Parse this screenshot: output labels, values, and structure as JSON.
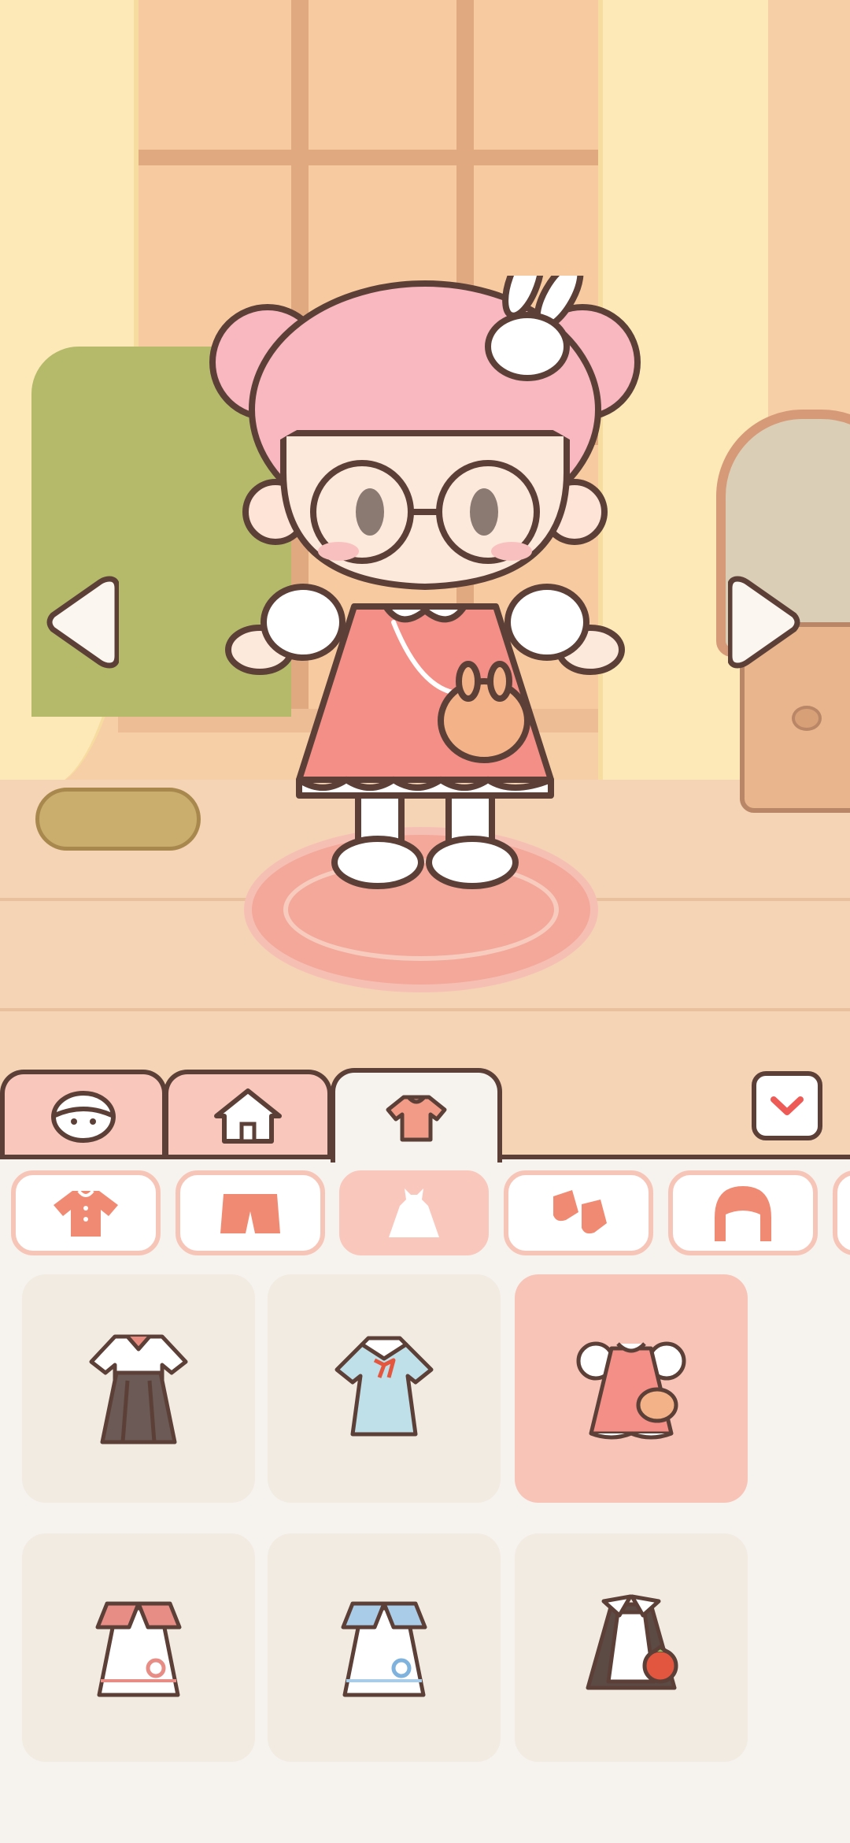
{
  "scene": {
    "room": "bedroom",
    "arrows": [
      "arrow-left",
      "arrow-right"
    ]
  },
  "tabs": [
    {
      "name": "face",
      "icon": "face-icon",
      "active": false
    },
    {
      "name": "home",
      "icon": "house-icon",
      "active": false
    },
    {
      "name": "clothes",
      "icon": "shirt-icon",
      "active": true
    }
  ],
  "categories": [
    {
      "name": "tops",
      "icon": "shirt-icon",
      "active": false
    },
    {
      "name": "bottoms",
      "icon": "shorts-icon",
      "active": false
    },
    {
      "name": "dresses",
      "icon": "dress-icon",
      "active": true
    },
    {
      "name": "socks",
      "icon": "socks-icon",
      "active": false
    },
    {
      "name": "hair",
      "icon": "hair-icon",
      "active": false
    }
  ],
  "items": [
    {
      "name": "school-uniform",
      "selected": false
    },
    {
      "name": "blue-sailor-dress",
      "selected": false
    },
    {
      "name": "pink-bunny-dress",
      "selected": true
    },
    {
      "name": "red-flower-dress",
      "selected": false
    },
    {
      "name": "blue-flower-dress",
      "selected": false
    },
    {
      "name": "maid-strawberry-dress",
      "selected": false
    }
  ],
  "colors": {
    "outline": "#5c4038",
    "accent": "#f9c7bb",
    "panel": "#f6f3ee",
    "card": "#f1ebe1",
    "icon": "#f08a72"
  }
}
